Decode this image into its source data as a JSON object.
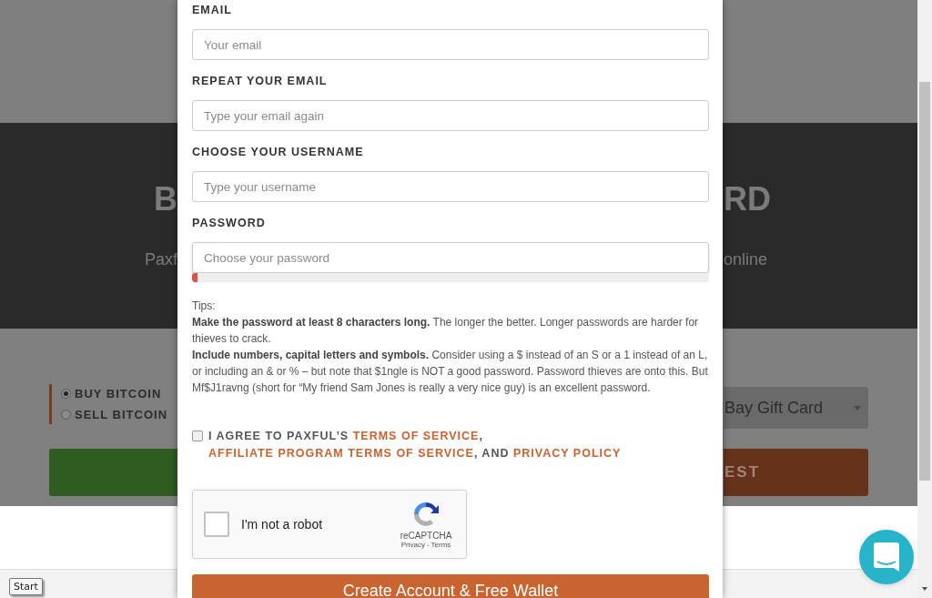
{
  "page": {
    "heading_left": "B",
    "heading_right": "RD",
    "subtitle_left": "Paxf",
    "subtitle_right": "online",
    "trade_options": [
      {
        "label": "BUY BITCOIN",
        "selected": true
      },
      {
        "label": "SELL BITCOIN",
        "selected": false
      }
    ],
    "payment_method": "Bay Gift Card",
    "action_button": "EST"
  },
  "modal": {
    "fields": [
      {
        "label": "EMAIL",
        "placeholder": "Your email"
      },
      {
        "label": "REPEAT YOUR EMAIL",
        "placeholder": "Type your email again"
      },
      {
        "label": "CHOOSE YOUR USERNAME",
        "placeholder": "Type your username"
      },
      {
        "label": "PASSWORD",
        "placeholder": "Choose your password",
        "kind": "password"
      }
    ],
    "password_strength": {
      "level": 0.01
    },
    "tips": {
      "title": "Tips:",
      "paragraphs": [
        "**Make the password at least 8 characters long.** The longer the better. Longer passwords are harder for thieves to crack.",
        "**Include numbers, capital letters and symbols.** Consider using a $ instead of an S or a 1 instead of an L, or including an & or % – but note that $1ngle is NOT a good password. Password thieves are onto this. But Mf$J1ravng (short for “My friend Sam Jones is really a very nice guy) is an excellent password."
      ]
    },
    "agreement": {
      "checked": false,
      "parts": [
        {
          "kind": "plain",
          "text": "I AGREE TO PAXFUL’S "
        },
        {
          "kind": "link",
          "text": "TERMS OF SERVICE"
        },
        {
          "kind": "plain",
          "text": ", "
        },
        {
          "kind": "link",
          "text": "AFFILIATE PROGRAM TERMS OF SERVICE"
        },
        {
          "kind": "plain",
          "text": ", AND "
        },
        {
          "kind": "link",
          "text": "PRIVACY POLICY"
        }
      ]
    },
    "captcha": {
      "checked": false,
      "label": "I'm not a robot",
      "brand": "reCAPTCHA",
      "privacy": "Privacy",
      "separator": "-",
      "terms": "Terms"
    },
    "submit": "Create Account & Free Wallet"
  },
  "taskbar": {
    "start": "Start"
  }
}
